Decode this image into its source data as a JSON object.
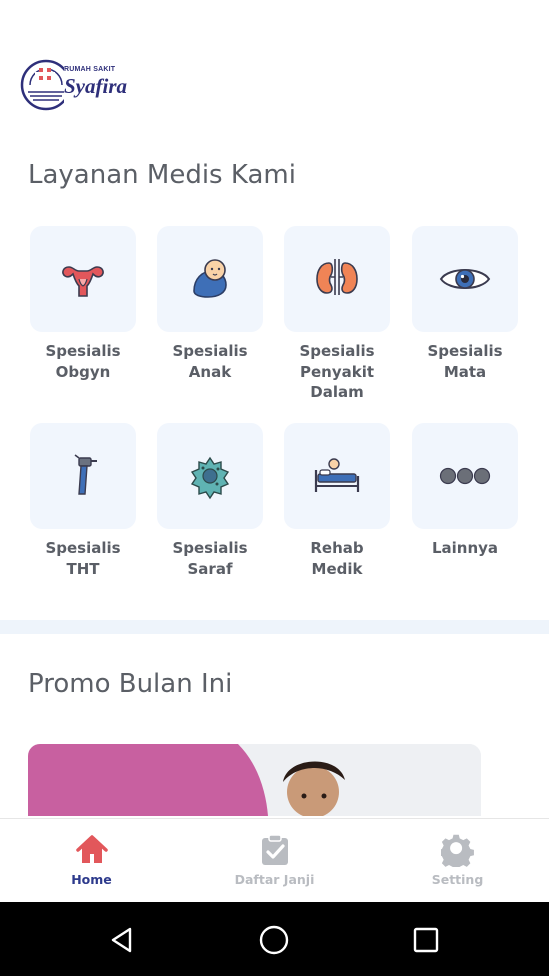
{
  "header": {
    "logo_top": "RUMAH SAKIT",
    "logo_main": "Syafira"
  },
  "services": {
    "title": "Layanan Medis Kami",
    "items": [
      {
        "label": "Spesialis\nObgyn",
        "icon": "uterus-icon"
      },
      {
        "label": "Spesialis\nAnak",
        "icon": "baby-icon"
      },
      {
        "label": "Spesialis\nPenyakit\nDalam",
        "icon": "kidney-icon"
      },
      {
        "label": "Spesialis\nMata",
        "icon": "eye-icon"
      },
      {
        "label": "Spesialis\nTHT",
        "icon": "otoscope-icon"
      },
      {
        "label": "Spesialis\nSaraf",
        "icon": "neuron-icon"
      },
      {
        "label": "Rehab\nMedik",
        "icon": "hospital-bed-icon"
      },
      {
        "label": "Lainnya",
        "icon": "more-dots-icon"
      }
    ]
  },
  "promo": {
    "title": "Promo Bulan Ini"
  },
  "bottom_nav": {
    "items": [
      {
        "label": "Home",
        "icon": "home-icon",
        "active": true
      },
      {
        "label": "Daftar Janji",
        "icon": "clipboard-check-icon",
        "active": false
      },
      {
        "label": "Setting",
        "icon": "gear-icon",
        "active": false
      }
    ]
  },
  "colors": {
    "accent": "#e2575b",
    "nav_active_label": "#2d3a8c",
    "nav_inactive": "#b9bcc1",
    "tile_bg": "#f1f6fd",
    "brand": "#2e2f7a"
  }
}
